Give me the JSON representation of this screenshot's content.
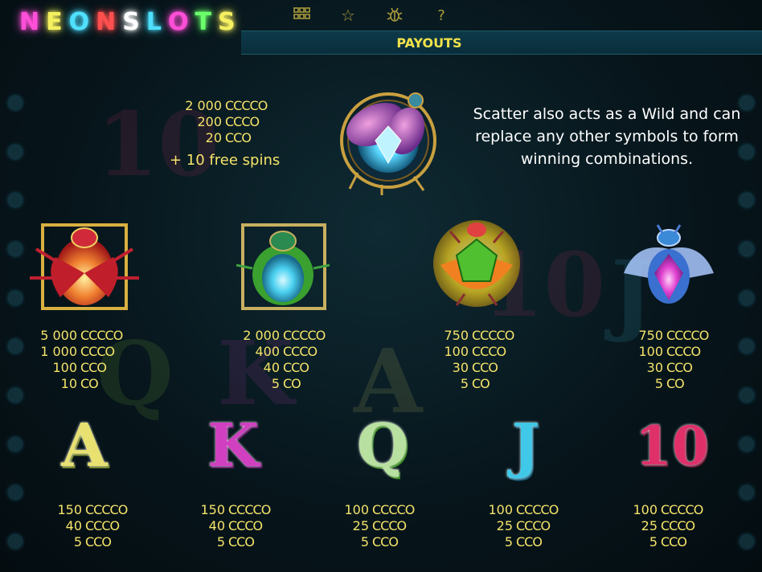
{
  "header": {
    "logo_letters": [
      "N",
      "E",
      "O",
      "N",
      "S",
      "L",
      "O",
      "T",
      "S"
    ],
    "logo_colors": [
      "#ff4fd8",
      "#f5f060",
      "#4fe0ff",
      "#ff4f4f",
      "#ffffff",
      "#4fe0ff",
      "#ff4fd8",
      "#6bff6b",
      "#f5f060"
    ],
    "menu_icons": [
      "grid-icon",
      "star-icon",
      "bug-icon",
      "help-icon"
    ],
    "help_glyph": "?",
    "star_glyph": "☆",
    "grid_glyph": "⠿",
    "bug_glyph": "⚉"
  },
  "title": "PAYOUTS",
  "scatter": {
    "payouts": [
      {
        "amount": "2 000",
        "combo": "CCCCO"
      },
      {
        "amount": "200",
        "combo": "CCCO"
      },
      {
        "amount": "20",
        "combo": "CCO"
      }
    ],
    "bonus": "+ 10 free spins",
    "description": "Scatter also acts as a Wild and can replace any other symbols to form winning combinations."
  },
  "high_symbols": [
    {
      "name": "red-beetle",
      "payouts": [
        {
          "amount": "5 000",
          "combo": "CCCCO"
        },
        {
          "amount": "1 000",
          "combo": "CCCO"
        },
        {
          "amount": "100",
          "combo": "CCO"
        },
        {
          "amount": "10",
          "combo": "CO"
        }
      ]
    },
    {
      "name": "green-beetle",
      "payouts": [
        {
          "amount": "2 000",
          "combo": "CCCCO"
        },
        {
          "amount": "400",
          "combo": "CCCO"
        },
        {
          "amount": "40",
          "combo": "CCO"
        },
        {
          "amount": "5",
          "combo": "CO"
        }
      ]
    },
    {
      "name": "yellow-beetle",
      "payouts": [
        {
          "amount": "750",
          "combo": "CCCCO"
        },
        {
          "amount": "100",
          "combo": "CCCO"
        },
        {
          "amount": "30",
          "combo": "CCO"
        },
        {
          "amount": "5",
          "combo": "CO"
        }
      ]
    },
    {
      "name": "blue-beetle",
      "payouts": [
        {
          "amount": "750",
          "combo": "CCCCO"
        },
        {
          "amount": "100",
          "combo": "CCCO"
        },
        {
          "amount": "30",
          "combo": "CCO"
        },
        {
          "amount": "5",
          "combo": "CO"
        }
      ]
    }
  ],
  "low_symbols": [
    {
      "letter": "A",
      "color": "#e8e070",
      "payouts": [
        {
          "amount": "150",
          "combo": "CCCCO"
        },
        {
          "amount": "40",
          "combo": "CCCO"
        },
        {
          "amount": "5",
          "combo": "CCO"
        }
      ]
    },
    {
      "letter": "K",
      "color": "#d040c0",
      "payouts": [
        {
          "amount": "150",
          "combo": "CCCCO"
        },
        {
          "amount": "40",
          "combo": "CCCO"
        },
        {
          "amount": "5",
          "combo": "CCO"
        }
      ]
    },
    {
      "letter": "Q",
      "color": "#8ad040",
      "payouts": [
        {
          "amount": "100",
          "combo": "CCCCO"
        },
        {
          "amount": "25",
          "combo": "CCCO"
        },
        {
          "amount": "5",
          "combo": "CCO"
        }
      ]
    },
    {
      "letter": "J",
      "color": "#40c8e8",
      "payouts": [
        {
          "amount": "100",
          "combo": "CCCCO"
        },
        {
          "amount": "25",
          "combo": "CCCO"
        },
        {
          "amount": "5",
          "combo": "CCO"
        }
      ]
    },
    {
      "letter": "10",
      "color": "#e0306a",
      "payouts": [
        {
          "amount": "100",
          "combo": "CCCCO"
        },
        {
          "amount": "25",
          "combo": "CCCO"
        },
        {
          "amount": "5",
          "combo": "CCO"
        }
      ]
    }
  ]
}
